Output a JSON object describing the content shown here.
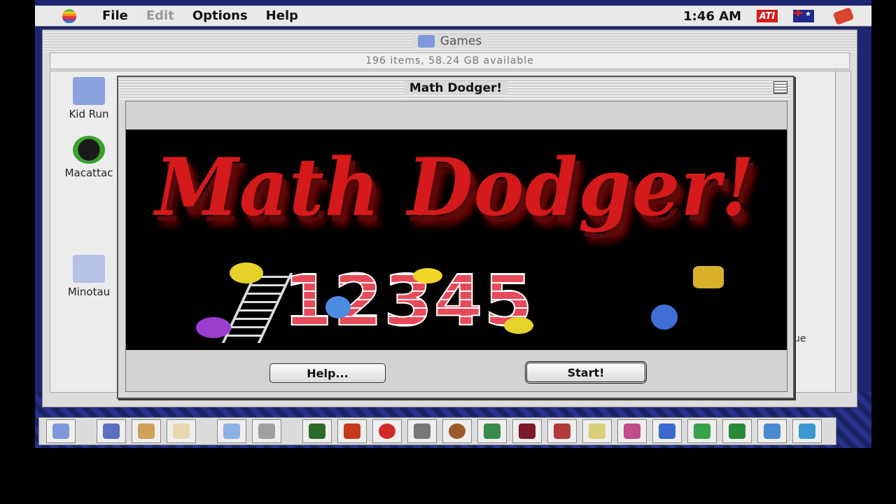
{
  "menubar": {
    "items": [
      {
        "label": "File",
        "enabled": true
      },
      {
        "label": "Edit",
        "enabled": false
      },
      {
        "label": "Options",
        "enabled": true
      },
      {
        "label": "Help",
        "enabled": true
      }
    ],
    "clock": "1:46 AM",
    "ati_label": "ATI"
  },
  "finder": {
    "title": "Games",
    "info": "196 items, 58.24 GB available",
    "icons": [
      {
        "label": "Kid Run"
      },
      {
        "label": "Macattac"
      },
      {
        "label": "Minotau"
      }
    ],
    "right_fragment": "ue"
  },
  "dialog": {
    "title": "Math Dodger!",
    "splash_title": "Math Dodger!",
    "numbers": [
      "1",
      "2",
      "3",
      "4",
      "5"
    ],
    "help_button": "Help...",
    "start_button": "Start!"
  },
  "colors": {
    "splash_red": "#d41a1a",
    "platinum": "#dcdcdc",
    "desktop_blue": "#1d2670"
  },
  "control_strip": {
    "icons": [
      "finder-icon",
      "disk-icon",
      "drive-icon",
      "note-icon",
      "cloud-icon",
      "copy-icon",
      "game-icon-1",
      "game-icon-2",
      "target-icon",
      "cross-icon",
      "face-icon",
      "mask-icon",
      "ninja-icon",
      "robot-icon",
      "ankh-icon",
      "octopus-icon",
      "sword-icon",
      "frog-icon",
      "frog-icon-2",
      "person-icon",
      "person-icon-2"
    ]
  }
}
